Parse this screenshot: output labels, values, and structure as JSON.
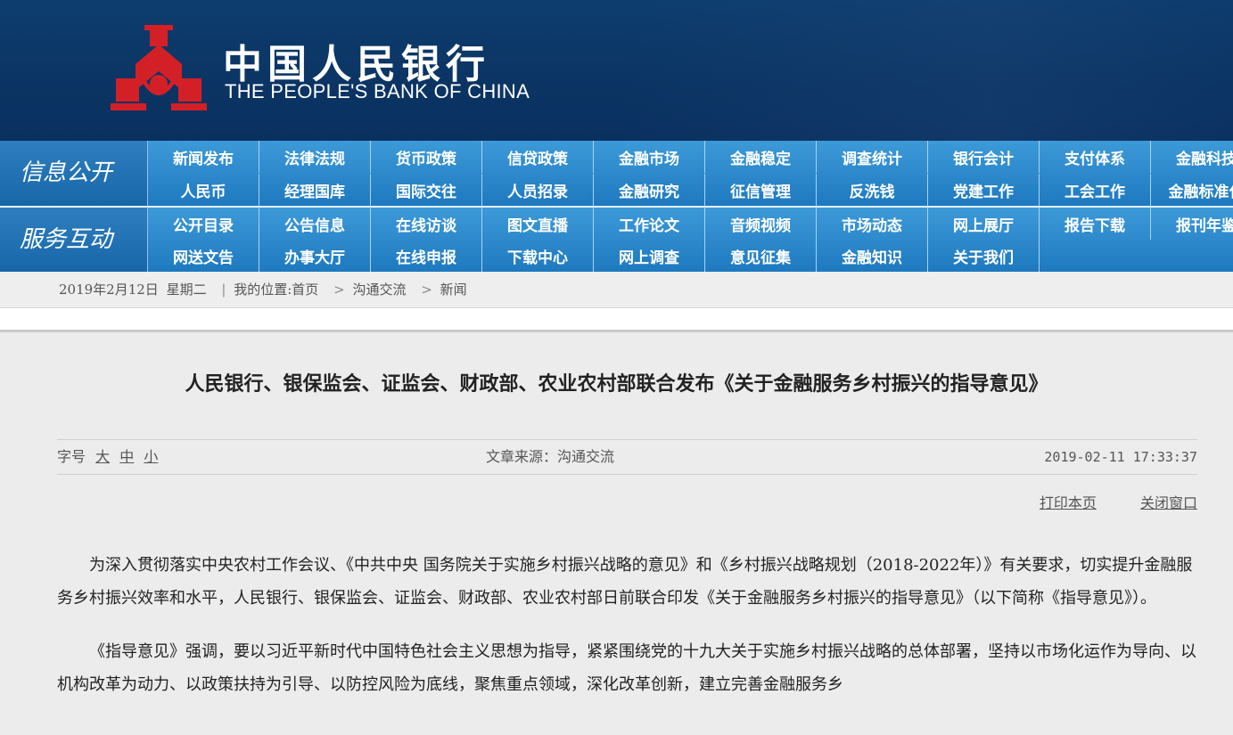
{
  "header": {
    "logo_cn": "中国人民银行",
    "logo_en": "THE PEOPLE'S BANK OF CHINA",
    "logo_icon": "pbc-emblem-icon",
    "colors": {
      "header_bg": "#0b3564",
      "emblem_red": "#d32027",
      "nav_blue": "#2a86cc"
    }
  },
  "nav": {
    "info_label": "信息公开",
    "service_label": "服务互动",
    "row1": [
      "新闻发布",
      "法律法规",
      "货币政策",
      "信贷政策",
      "金融市场",
      "金融稳定",
      "调查统计",
      "银行会计",
      "支付体系",
      "金融科技"
    ],
    "row2": [
      "人民币",
      "经理国库",
      "国际交往",
      "人员招录",
      "金融研究",
      "征信管理",
      "反洗钱",
      "党建工作",
      "工会工作",
      "金融标准化"
    ],
    "row3": [
      "公开目录",
      "公告信息",
      "在线访谈",
      "图文直播",
      "工作论文",
      "音频视频",
      "市场动态",
      "网上展厅",
      "报告下载",
      "报刊年鉴"
    ],
    "row4": [
      "网送文告",
      "办事大厅",
      "在线申报",
      "下载中心",
      "网上调查",
      "意见征集",
      "金融知识",
      "关于我们"
    ]
  },
  "breadcrumb": {
    "date": "2019年2月12日",
    "weekday": "星期二",
    "sep": "|",
    "location_label": "我的位置:",
    "home": "首页",
    "arrow": ">",
    "level1": "沟通交流",
    "level2": "新闻"
  },
  "article": {
    "title": "人民银行、银保监会、证监会、财政部、农业农村部联合发布《关于金融服务乡村振兴的指导意见》",
    "font_size_label": "字号",
    "font_large": "大",
    "font_medium": "中",
    "font_small": "小",
    "source": "文章来源：沟通交流",
    "datetime": "2019-02-11 17:33:37",
    "print": "打印本页",
    "close": "关闭窗口",
    "paragraphs": [
      "为深入贯彻落实中央农村工作会议、《中共中央 国务院关于实施乡村振兴战略的意见》和《乡村振兴战略规划（2018-2022年）》有关要求，切实提升金融服务乡村振兴效率和水平，人民银行、银保监会、证监会、财政部、农业农村部日前联合印发《关于金融服务乡村振兴的指导意见》（以下简称《指导意见》）。",
      "《指导意见》强调，要以习近平新时代中国特色社会主义思想为指导，紧紧围绕党的十九大关于实施乡村振兴战略的总体部署，坚持以市场化运作为导向、以机构改革为动力、以政策扶持为引导、以防控风险为底线，聚焦重点领域，深化改革创新，建立完善金融服务乡"
    ]
  }
}
